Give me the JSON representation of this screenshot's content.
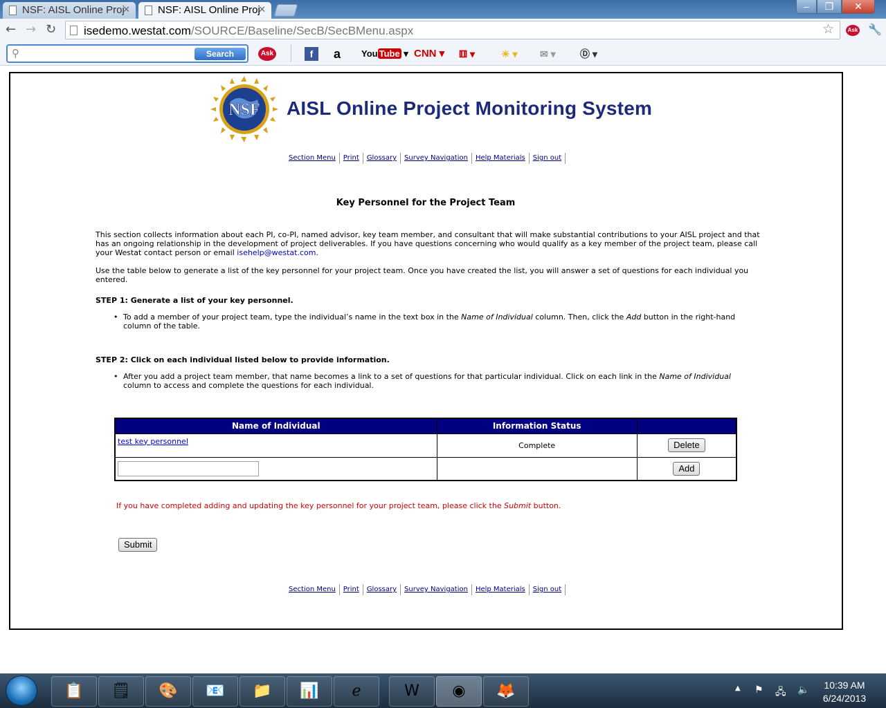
{
  "browser": {
    "tabs": [
      {
        "label": "NSF: AISL Online Proj",
        "active": false
      },
      {
        "label": "NSF: AISL Online Proj",
        "active": true
      }
    ],
    "url_host": "isedemo.westat.com",
    "url_path": "/SOURCE/Baseline/SecB/SecBMenu.aspx",
    "ask_search_label": "Search",
    "ask_logo": "Ask",
    "toolbar_icons": [
      "facebook-icon",
      "amazon-icon",
      "youtube-icon",
      "cnn-icon",
      "games-icon",
      "weather-icon",
      "mail-icon",
      "dictionary-icon"
    ]
  },
  "header": {
    "logo_text": "NSF",
    "title": "AISL Online Project Monitoring System"
  },
  "nav": {
    "section_menu": "Section Menu",
    "print": "Print",
    "glossary": "Glossary",
    "survey_navigation": "Survey Navigation",
    "help_materials": "Help Materials",
    "sign_out": "Sign out"
  },
  "main": {
    "heading": "Key Personnel for the Project Team",
    "intro_1": "This section collects information about each PI, co-PI, named advisor, key team member, and consultant that will make substantial contributions to your AISL project and that has an ongoing relationship in the development of project deliverables. If you have questions concerning who would qualify as a key member of the project team, please call your Westat contact person or email ",
    "email": "isehelp@westat.com",
    "intro_1_end": ".",
    "intro_2": "Use the table below to generate a list of the key personnel for your project team. Once you have created the list, you will answer a set of questions for each individual you entered.",
    "step1_title": "STEP 1: Generate a list of your key personnel.",
    "step1_a": "To add a member of your project team, type the individual’s name in the text box in the ",
    "step1_em1": "Name of Individual",
    "step1_b": " column. Then, click the ",
    "step1_em2": "Add",
    "step1_c": " button in the right-hand column of the table.",
    "step2_title": "STEP 2: Click on each individual listed below to provide information.",
    "step2_a": "After you add a project team member, that name becomes a link to a set of questions for that particular individual. Click on each link in the ",
    "step2_em": "Name of Individual",
    "step2_b": " column to access and complete the questions for each individual.",
    "table": {
      "headers": [
        "Name of Individual",
        "Information Status",
        ""
      ],
      "rows": [
        {
          "name": "test key personnel",
          "status": "Complete",
          "action": "Delete"
        }
      ],
      "new_row": {
        "name_value": "",
        "action": "Add"
      }
    },
    "submit_msg_a": "If you have completed adding and updating the key personnel for your project team, please click the ",
    "submit_msg_em": "Submit",
    "submit_msg_b": " button.",
    "submit_label": "Submit"
  },
  "taskbar": {
    "time": "10:39 AM",
    "date": "6/24/2013"
  }
}
